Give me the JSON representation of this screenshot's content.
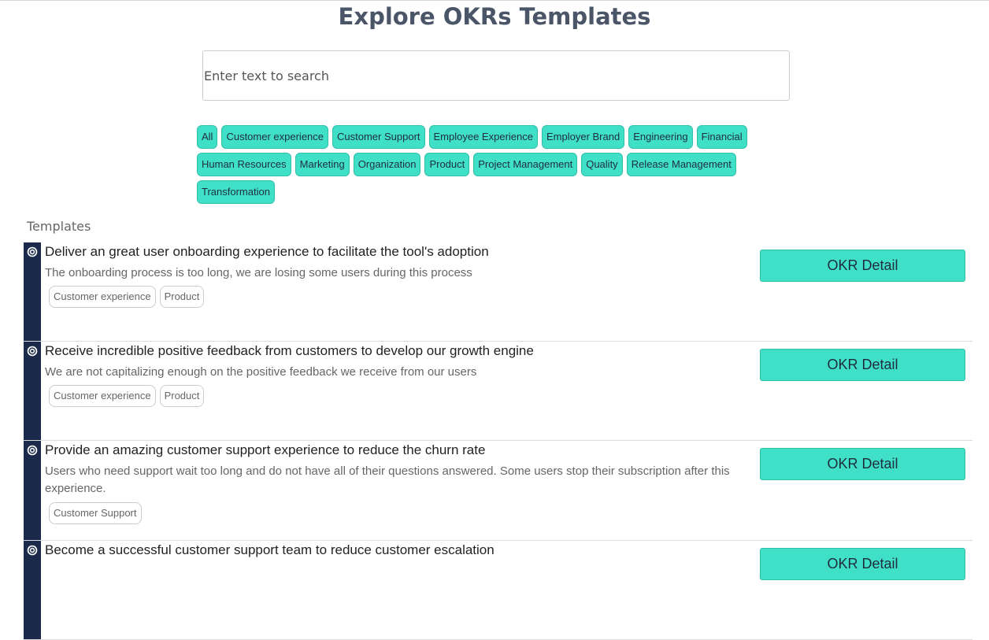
{
  "page_title": "Explore OKRs Templates",
  "search": {
    "placeholder": "Enter text to search",
    "value": ""
  },
  "filters": [
    "All",
    "Customer experience",
    "Customer Support",
    "Employee Experience",
    "Employer Brand",
    "Engineering",
    "Financial",
    "Human Resources",
    "Marketing",
    "Organization",
    "Product",
    "Project Management",
    "Quality",
    "Release Management",
    "Transformation"
  ],
  "templates_label": "Templates",
  "templates": [
    {
      "title": "Deliver an great user onboarding experience to facilitate the tool's adoption",
      "description": "The onboarding process is too long, we are losing some users during this process",
      "tags": [
        "Customer experience",
        "Product"
      ],
      "button": "OKR Detail"
    },
    {
      "title": "Receive incredible positive feedback from customers to develop our growth engine",
      "description": "We are not capitalizing enough on the positive feedback we receive from our users",
      "tags": [
        "Customer experience",
        "Product"
      ],
      "button": "OKR Detail"
    },
    {
      "title": "Provide an amazing customer support experience to reduce the churn rate",
      "description": "Users who need support wait too long and do not have all of their questions answered. Some users stop their subscription after this experience.",
      "tags": [
        "Customer Support"
      ],
      "button": "OKR Detail"
    },
    {
      "title": "Become a successful customer support team to reduce customer escalation",
      "description": "",
      "tags": [],
      "button": "OKR Detail"
    }
  ],
  "colors": {
    "accent": "#40e0c8",
    "sidebar_bar": "#1b2a4a",
    "title": "#4a5568"
  },
  "icons": {
    "row_icon": "target-icon"
  }
}
